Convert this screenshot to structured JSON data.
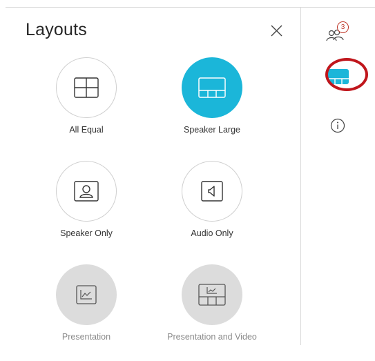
{
  "panel": {
    "title": "Layouts"
  },
  "layouts": [
    {
      "id": "all-equal",
      "label": "All Equal",
      "state": "normal"
    },
    {
      "id": "speaker-large",
      "label": "Speaker Large",
      "state": "selected"
    },
    {
      "id": "speaker-only",
      "label": "Speaker Only",
      "state": "normal"
    },
    {
      "id": "audio-only",
      "label": "Audio Only",
      "state": "normal"
    },
    {
      "id": "presentation",
      "label": "Presentation",
      "state": "disabled"
    },
    {
      "id": "presentation-and-video",
      "label": "Presentation and Video",
      "state": "disabled"
    }
  ],
  "rail": {
    "participants_count": "3",
    "icons": [
      "participants-icon",
      "layout-icon",
      "info-icon"
    ]
  },
  "colors": {
    "accent": "#1bb6d9",
    "highlight": "#c0161c",
    "disabled_fill": "#dcdcdc",
    "badge": "#c0392b"
  }
}
